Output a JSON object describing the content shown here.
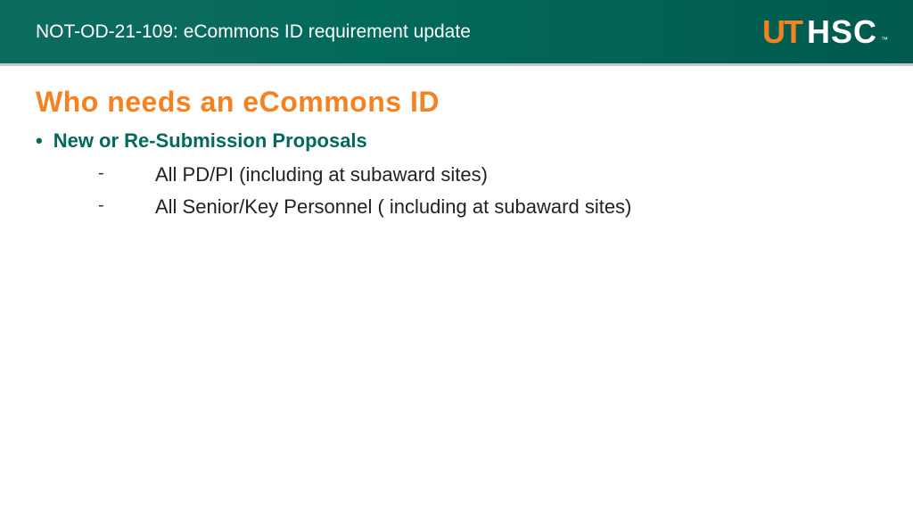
{
  "header": {
    "title": "NOT-OD-21-109: eCommons ID requirement update",
    "logo_ut": "UT",
    "logo_hsc": "HSC",
    "logo_tm": "™"
  },
  "slide": {
    "title": "Who needs an eCommons ID",
    "bullet_main": "New or Re-Submission Proposals",
    "sub_items": [
      "All PD/PI (including at subaward sites)",
      "All Senior/Key Personnel ( including at subaward sites)"
    ]
  }
}
